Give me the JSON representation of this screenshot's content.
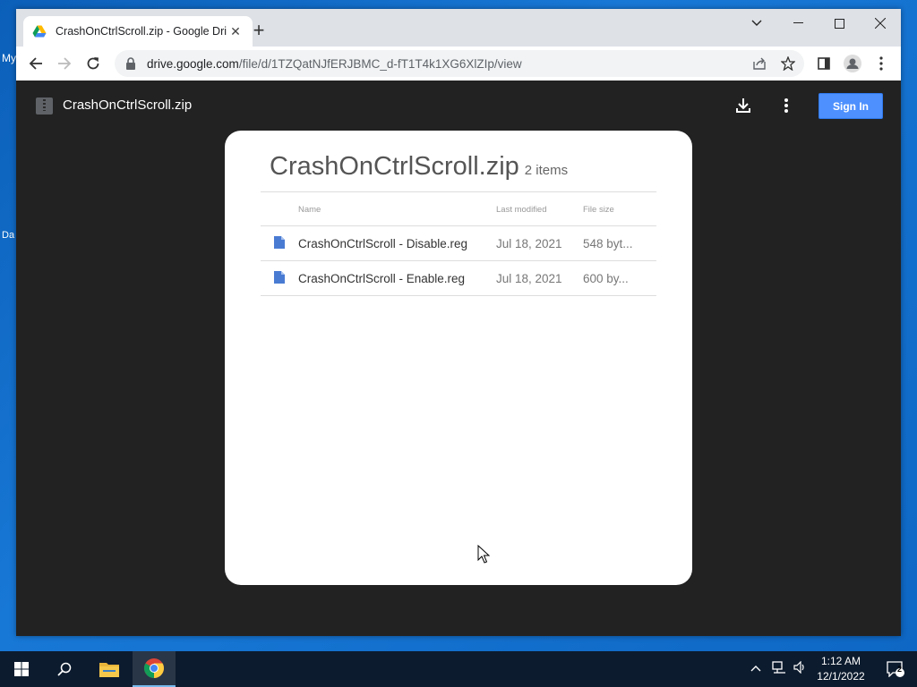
{
  "desktop": {
    "icon_labels": [
      "My",
      "Da"
    ]
  },
  "browser": {
    "tab_title": "CrashOnCtrlScroll.zip - Google Dri",
    "url_host": "drive.google.com",
    "url_path": "/file/d/1TZQatNJfERJBMC_d-fT1T4k1XG6XlZIp/view"
  },
  "viewer": {
    "file_name": "CrashOnCtrlScroll.zip",
    "signin_label": "Sign In",
    "card_title": "CrashOnCtrlScroll.zip",
    "item_count": "2 items",
    "columns": {
      "name": "Name",
      "modified": "Last modified",
      "size": "File size"
    },
    "files": [
      {
        "name": "CrashOnCtrlScroll - Disable.reg",
        "modified": "Jul 18, 2021",
        "size": "548 byt..."
      },
      {
        "name": "CrashOnCtrlScroll - Enable.reg",
        "modified": "Jul 18, 2021",
        "size": "600 by..."
      }
    ]
  },
  "taskbar": {
    "time": "1:12 AM",
    "date": "12/1/2022",
    "notification_count": "2"
  },
  "colors": {
    "accent": "#4d90fe",
    "viewer_bg": "#222222",
    "file_icon": "#4a7bd3"
  }
}
